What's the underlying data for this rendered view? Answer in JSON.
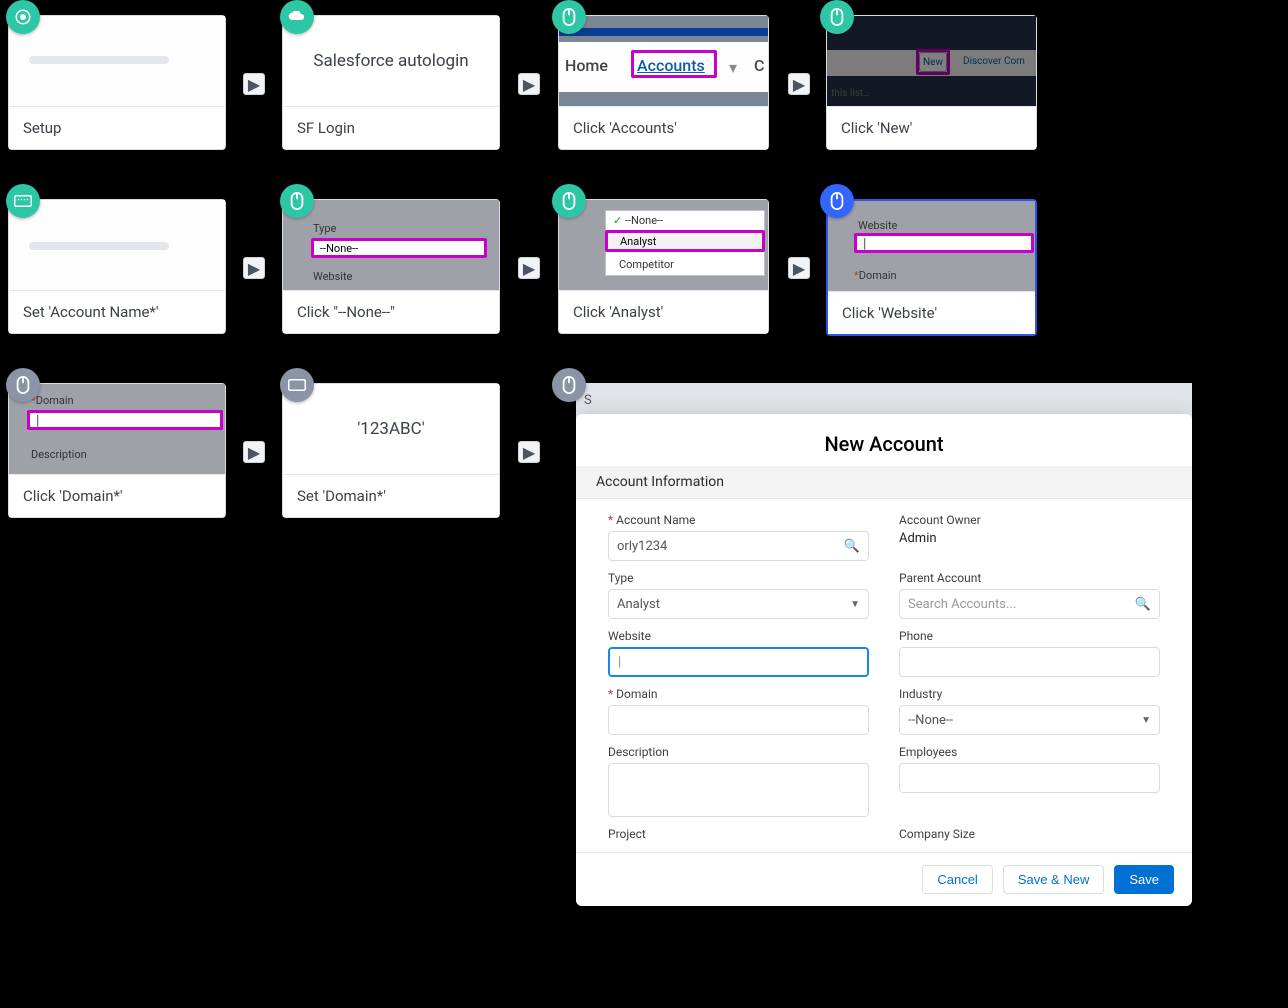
{
  "steps": {
    "setup": {
      "label": "Setup"
    },
    "sf_login": {
      "label": "SF Login",
      "prompt": "Salesforce autologin"
    },
    "click_accounts": {
      "label": "Click 'Accounts'",
      "tabs": {
        "home": "Home",
        "accounts": "Accounts",
        "other": "C"
      }
    },
    "click_new": {
      "label": "Click 'New'",
      "button": "New",
      "sec": "Discover Com",
      "hint": "this list…"
    },
    "set_account_name": {
      "label": "Set 'Account Name*'"
    },
    "click_none": {
      "label": "Click \"--None--\"",
      "field_type": "Type",
      "value": "--None--",
      "below": "Website"
    },
    "click_analyst": {
      "label": "Click 'Analyst'",
      "opt_none": " --None--",
      "opt_analyst": "Analyst",
      "opt_comp": "Competitor"
    },
    "click_website": {
      "label": "Click 'Website'",
      "lab_web": "Website",
      "lab_domain": "Domain"
    },
    "click_domain": {
      "label": "Click 'Domain*'",
      "lab_domain": "Domain",
      "lab_desc": "Description"
    },
    "set_domain": {
      "label": "Set 'Domain*'",
      "prompt": "'123ABC'"
    },
    "last": {
      "label": ""
    }
  },
  "sf": {
    "title": "New Account",
    "section": "Account Information",
    "labels": {
      "account_name": "Account Name",
      "account_owner": "Account Owner",
      "type": "Type",
      "parent": "Parent Account",
      "website": "Website",
      "phone": "Phone",
      "domain": "Domain",
      "industry": "Industry",
      "description": "Description",
      "employees": "Employees",
      "project": "Project",
      "company_size": "Company Size"
    },
    "values": {
      "account_name": "orly1234",
      "owner": "Admin",
      "type": "Analyst",
      "parent_placeholder": "Search Accounts...",
      "industry": "--None--"
    },
    "buttons": {
      "cancel": "Cancel",
      "save_new": "Save & New",
      "save": "Save"
    }
  }
}
